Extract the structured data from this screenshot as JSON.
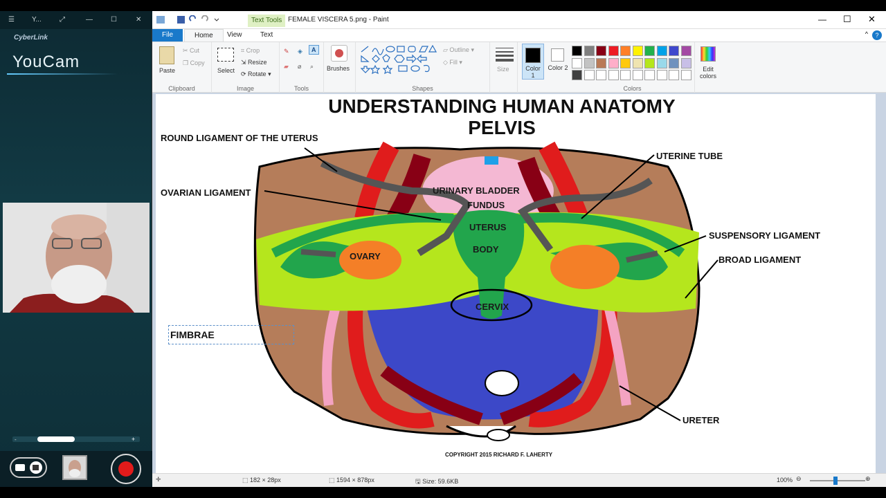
{
  "youcam": {
    "tab_label": "Y...",
    "brand": "CyberLink",
    "app_name": "YouCam"
  },
  "paint": {
    "window_title": "FEMALE VISCERA 5.png - Paint",
    "context_tab": "Text Tools",
    "tabs": [
      "File",
      "Home",
      "View",
      "Text"
    ],
    "clipboard": {
      "paste": "Paste",
      "cut": "Cut",
      "copy": "Copy",
      "label": "Clipboard"
    },
    "image": {
      "select": "Select",
      "crop": "Crop",
      "resize": "Resize",
      "rotate": "Rotate",
      "label": "Image"
    },
    "tools_label": "Tools",
    "brushes": "Brushes",
    "shapes": {
      "outline": "Outline",
      "fill": "Fill",
      "label": "Shapes"
    },
    "size": "Size",
    "color1": "Color 1",
    "color2": "Color 2",
    "colors_label": "Colors",
    "edit_colors": "Edit colors",
    "palette": [
      "#000000",
      "#7f7f7f",
      "#880015",
      "#ed1c24",
      "#ff7f27",
      "#fff200",
      "#22b14c",
      "#00a2e8",
      "#3f48cc",
      "#a349a4",
      "#ffffff",
      "#c3c3c3",
      "#b97a57",
      "#ffaec9",
      "#ffc90e",
      "#efe4b0",
      "#b5e61d",
      "#99d9ea",
      "#7092be",
      "#c8bfe7",
      "#404040",
      "#ffffff",
      "#ffffff",
      "#ffffff",
      "#ffffff",
      "#ffffff",
      "#ffffff",
      "#ffffff",
      "#ffffff",
      "#ffffff"
    ]
  },
  "diagram": {
    "title1": "UNDERSTANDING HUMAN ANATOMY",
    "title2": "PELVIS",
    "labels": {
      "round": "ROUND LIGAMENT OF THE UTERUS",
      "ovarian": "OVARIAN LIGAMENT",
      "uterine_tube": "UTERINE TUBE",
      "suspensory": "SUSPENSORY LIGAMENT",
      "broad": "BROAD LIGAMENT",
      "ureter": "URETER",
      "fimbrae": "FIMBRAE",
      "bladder": "URINARY BLADDER",
      "fundus": "FUNDUS",
      "uterus": "UTERUS",
      "body": "BODY",
      "ovary": "OVARY",
      "cervix": "CERVIX"
    },
    "copyright": "COPYRIGHT 2015 RICHARD F. LAHERTY"
  },
  "status": {
    "selection": "182 × 28px",
    "canvas_size": "1594 × 878px",
    "file_size": "Size: 59.6KB",
    "zoom": "100%"
  }
}
